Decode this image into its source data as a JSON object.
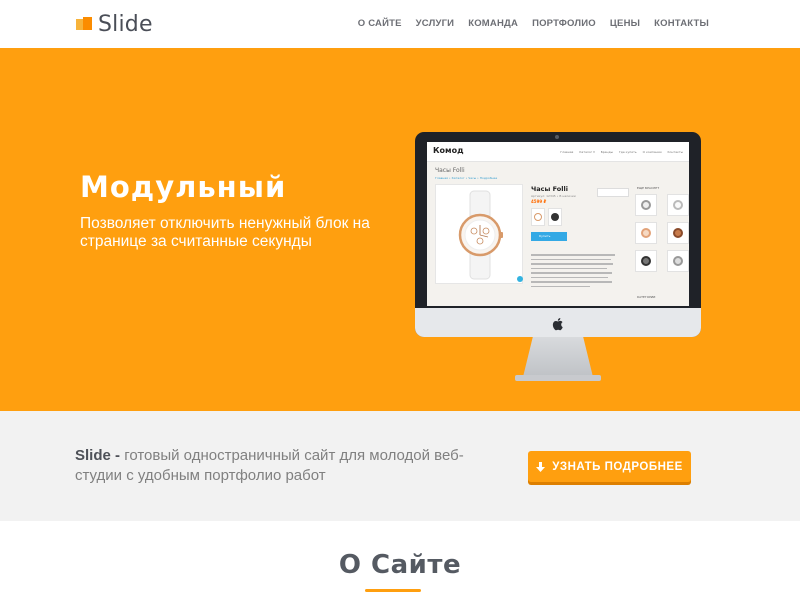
{
  "header": {
    "logo_text": "Slide",
    "nav": [
      "О САЙТЕ",
      "УСЛУГИ",
      "КОМАНДА",
      "ПОРТФОЛИО",
      "ЦЕНЫ",
      "КОНТАКТЫ"
    ]
  },
  "hero": {
    "title": "Модульный",
    "subtitle": "Позволяет отключить ненужный блок на странице за считанные секунды",
    "screen": {
      "logo": "Комод",
      "nav": [
        "Главная",
        "Каталог ▾",
        "Бренды",
        "Где купить",
        "О компании",
        "Контакты"
      ],
      "page_title": "Часы Folli",
      "breadcrumbs": "Главная • Каталог • Часы • Подробнее",
      "product_name": "Часы Folli",
      "product_meta": "Артикул: 12345 • В наличии",
      "price": "4599 ₽",
      "buy_label": "Купить",
      "sidebar_title": "ЕЩЕ БРАСЛЕТ",
      "sidebar_bottom": "КАТЕГОРИИ"
    }
  },
  "band": {
    "brand": "Slide -",
    "text": "готовый одностраничный сайт для молодой веб-студии с удобным портфолио работ",
    "cta_label": "УЗНАТЬ ПОДРОБНЕЕ"
  },
  "section": {
    "title": "О Сайте"
  },
  "colors": {
    "accent": "#ff9f0f",
    "accent_dark": "#dd7f00",
    "text_dark": "#4e5158",
    "text_muted": "#808080",
    "band_bg": "#f2f2f2"
  },
  "icons": {
    "logo": "slide-logo-icon",
    "apple": "apple-logo-icon",
    "cta": "arrow-down-icon"
  }
}
